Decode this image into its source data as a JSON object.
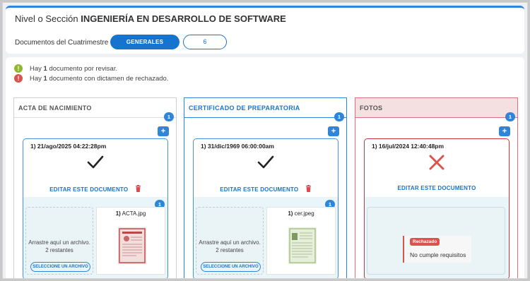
{
  "header": {
    "title_prefix": "Nivel o Sección",
    "title_value": "INGENIERÍA EN DESARROLLO DE SOFTWARE",
    "docs_label": "Documentos del Cuatrimestre",
    "tab_generales": "GENERALES",
    "tab_number": "6"
  },
  "alerts": [
    {
      "pre": "Hay ",
      "count": "1",
      "post": " documento por revisar.",
      "icon": "exclamation-warning-icon",
      "color": "#8fb830"
    },
    {
      "pre": "Hay ",
      "count": "1",
      "post": " documento con dictamen de rechazado.",
      "icon": "exclamation-error-icon",
      "color": "#d9534f"
    }
  ],
  "columns": [
    {
      "title": "ACTA DE NACIMIENTO",
      "count": "1",
      "add": "+",
      "card": {
        "date": "1) 21/ago/2025 04:22:28pm",
        "status_icon": "check-icon",
        "edit_label": "EDITAR ESTE DOCUMENTO",
        "file_count": "1",
        "drop_line1": "Arrastre aquí un archivo.",
        "drop_line2": "2 restantes",
        "select_label": "SELECCIONE UN ARCHIVO",
        "file_index": "1)",
        "file_name": " ACTA.jpg"
      }
    },
    {
      "title": "CERTIFICADO DE PREPARATORIA",
      "count": "1",
      "add": "+",
      "card": {
        "date": "1) 31/dic/1969 06:00:00am",
        "status_icon": "check-icon",
        "edit_label": "EDITAR ESTE DOCUMENTO",
        "file_count": "1",
        "drop_line1": "Arrastre aquí un archivo.",
        "drop_line2": "2 restantes",
        "select_label": "SELECCIONE UN ARCHIVO",
        "file_index": "1)",
        "file_name": " cer.jpeg"
      }
    },
    {
      "title": "FOTOS",
      "count": "1",
      "add": "+",
      "card": {
        "date": "1) 16/jul/2024 12:40:48pm",
        "status_icon": "x-reject-icon",
        "edit_label": "EDITAR ESTE DOCUMENTO",
        "status_badge": "Rechazado",
        "status_reason": "No cumple requisitos"
      }
    }
  ],
  "colors": {
    "primary": "#1674cf",
    "success": "#8fb830",
    "danger": "#d9534f",
    "reject_bg": "#f4dfe1"
  }
}
